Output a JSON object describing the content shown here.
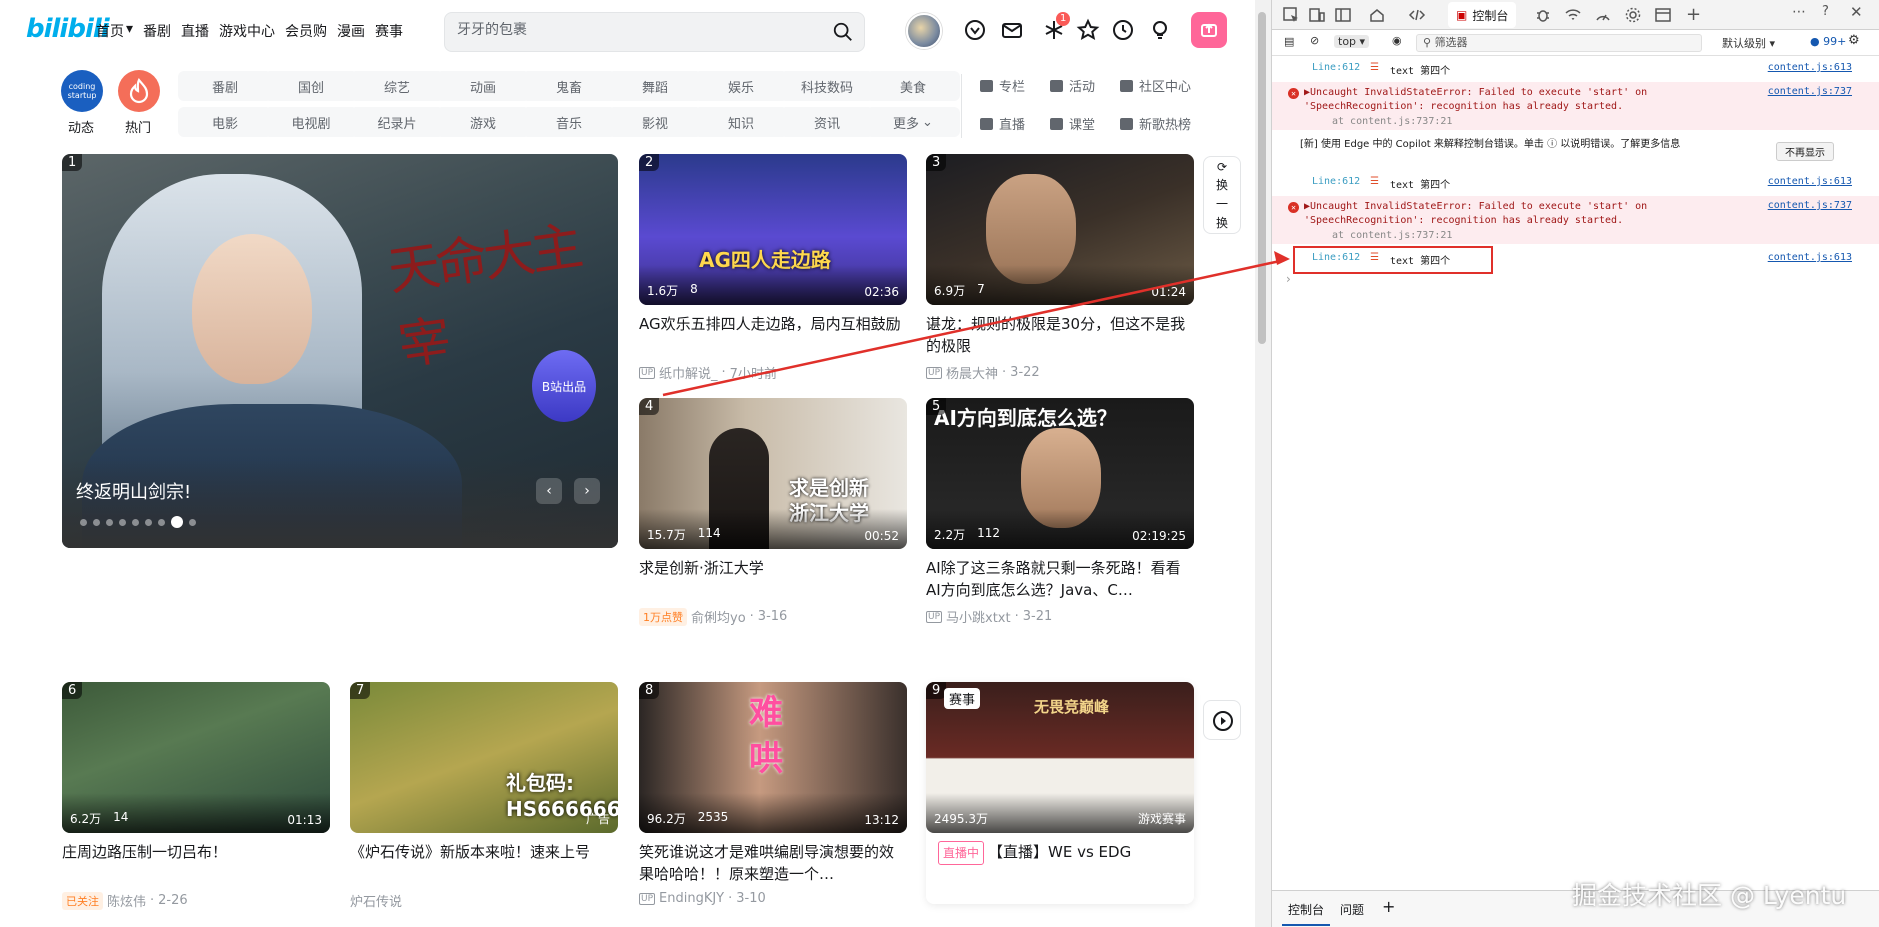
{
  "header": {
    "logo": "bilibili",
    "nav": [
      "首页",
      "番剧",
      "直播",
      "游戏中心",
      "会员购",
      "漫画",
      "赛事"
    ],
    "search_placeholder": "牙牙的包裹",
    "notification_badge": "1"
  },
  "channels": {
    "dynamic_label": "动态",
    "dynamic_badge": "coding startup",
    "hot_label": "热门",
    "row1": [
      "番剧",
      "国创",
      "综艺",
      "动画",
      "鬼畜",
      "舞蹈",
      "娱乐",
      "科技数码",
      "美食"
    ],
    "row2": [
      "电影",
      "电视剧",
      "纪录片",
      "游戏",
      "音乐",
      "影视",
      "知识",
      "资讯",
      "更多"
    ],
    "side": [
      "专栏",
      "活动",
      "社区中心",
      "直播",
      "课堂",
      "新歌热榜"
    ]
  },
  "banner": {
    "rank": "1",
    "title": "终返明山剑宗!",
    "calligraphy": "天命大主宰",
    "seal": "B站出品",
    "slides": 9,
    "active_slide": 7
  },
  "refresh": {
    "line1": "换",
    "line2": "一",
    "line3": "换"
  },
  "cards": [
    {
      "rank": "2",
      "views": "1.6万",
      "danmaku": "8",
      "duration": "02:36",
      "title": "AG欢乐五排四人走边路，局内互相鼓励",
      "up": "纸巾解说_",
      "date": "7小时前",
      "overlay": "AG四人走边路"
    },
    {
      "rank": "3",
      "views": "6.9万",
      "danmaku": "7",
      "duration": "01:24",
      "title": "谌龙：规则的极限是30分，但这不是我的极限",
      "up": "杨晨大神",
      "date": "3-22",
      "overlay": ""
    },
    {
      "rank": "4",
      "views": "15.7万",
      "danmaku": "114",
      "duration": "00:52",
      "title": "求是创新·浙江大学",
      "up": "俞俐均yo",
      "date": "3-16",
      "tag": "1万点赞",
      "overlay": "求是创新\n浙江大学"
    },
    {
      "rank": "5",
      "views": "2.2万",
      "danmaku": "112",
      "duration": "02:19:25",
      "title": "AI除了这三条路就只剩一条死路！看看AI方向到底怎么选？Java、C…",
      "up": "马小跳xtxt",
      "date": "3-21",
      "overlay": "AI方向到底怎么选？"
    },
    {
      "rank": "6",
      "views": "6.2万",
      "danmaku": "14",
      "duration": "01:13",
      "title": "庄周边路压制一切吕布！",
      "up": "陈炫伟",
      "date": "2-26",
      "tag": "已关注",
      "overlay": ""
    },
    {
      "rank": "7",
      "views": "",
      "danmaku": "",
      "duration": "广告",
      "title": "《炉石传说》新版本来啦！速来上号",
      "up": "炉石传说",
      "date": "",
      "overlay": "礼包码:\nHS666666"
    },
    {
      "rank": "8",
      "views": "96.2万",
      "danmaku": "2535",
      "duration": "13:12",
      "title": "笑死谁说这才是难哄编剧导演想要的效果哈哈哈！！原来塑造一个…",
      "up": "EndingKJY",
      "date": "3-10",
      "overlay": "难\n哄"
    },
    {
      "rank": "9",
      "views": "2495.3万",
      "danmaku": "",
      "duration": "游戏赛事",
      "title": "【直播】WE vs EDG",
      "up": "",
      "date": "",
      "tag": "直播中",
      "corner": "赛事",
      "overlay": "无畏竞巅峰"
    }
  ],
  "devtools": {
    "console_tab": "控制台",
    "context": "top",
    "filter_placeholder": "筛选器",
    "level": "默认级别",
    "issues_count": "99+",
    "logs": [
      {
        "type": "log",
        "line": "Line:612",
        "text": "text 第四个",
        "src": "content.js:613"
      },
      {
        "type": "error",
        "text": "▶Uncaught InvalidStateError: Failed to execute 'start' on 'SpeechRecognition': recognition has already started.",
        "at": "at content.js:737:21",
        "src": "content.js:737"
      },
      {
        "type": "info",
        "text": "[新] 使用 Edge 中的 Copilot 来解释控制台错误。单击 ⓘ 以说明错误。了解更多信息",
        "button": "不再显示"
      },
      {
        "type": "log",
        "line": "Line:612",
        "text": "text 第四个",
        "src": "content.js:613"
      },
      {
        "type": "error",
        "text": "▶Uncaught InvalidStateError: Failed to execute 'start' on 'SpeechRecognition': recognition has already started.",
        "at": "at content.js:737:21",
        "src": "content.js:737"
      },
      {
        "type": "log",
        "line": "Line:612",
        "text": "text 第四个",
        "src": "content.js:613"
      }
    ],
    "bottom_tabs": [
      "控制台",
      "问题"
    ]
  },
  "watermark": "掘金技术社区 @ Lyentu"
}
